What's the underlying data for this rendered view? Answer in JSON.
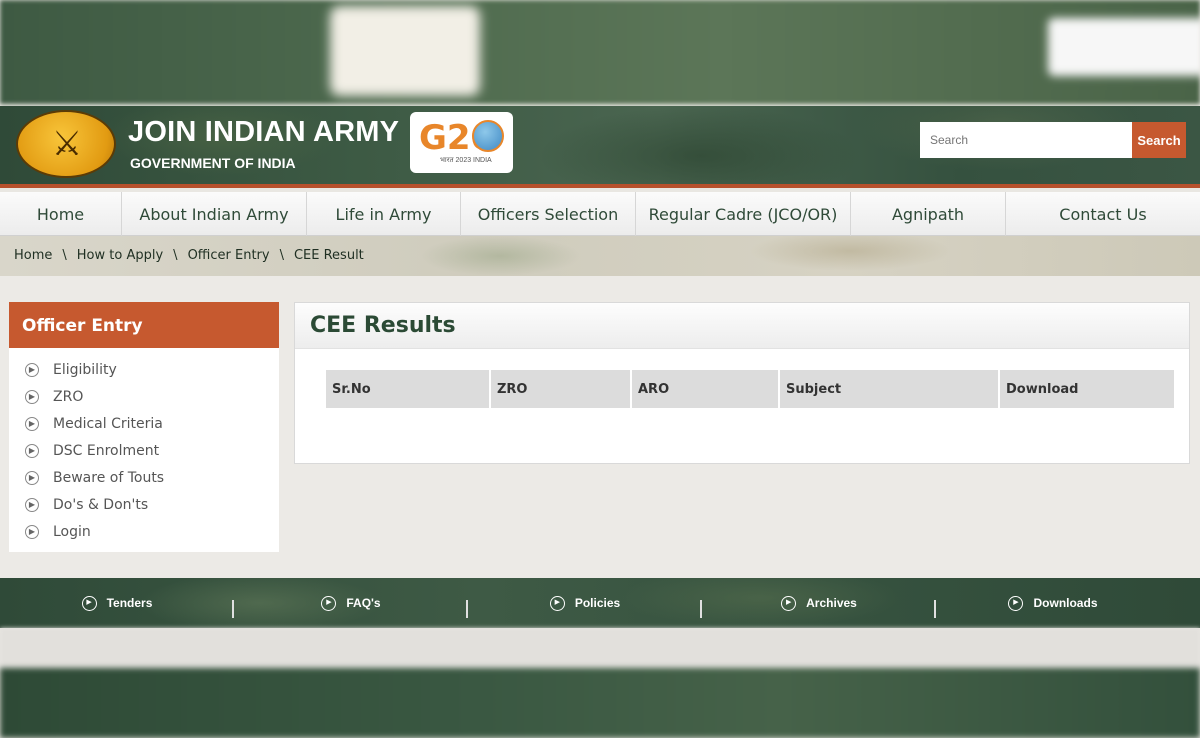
{
  "header": {
    "title": "JOIN INDIAN ARMY",
    "subtitle": "GOVERNMENT OF INDIA",
    "g20_logo_text": "G20",
    "g20_tagline": "भारत 2023 INDIA",
    "search_placeholder": "Search",
    "search_button": "Search"
  },
  "nav": {
    "items": [
      {
        "label": "Home"
      },
      {
        "label": "About Indian Army"
      },
      {
        "label": "Life in Army"
      },
      {
        "label": "Officers Selection"
      },
      {
        "label": "Regular Cadre (JCO/OR)"
      },
      {
        "label": "Agnipath"
      },
      {
        "label": "Contact Us"
      }
    ]
  },
  "breadcrumb": {
    "items": [
      "Home",
      "How to Apply",
      "Officer Entry",
      "CEE Result"
    ],
    "separator": "\\"
  },
  "sidebar": {
    "heading": "Officer Entry",
    "items": [
      "Eligibility",
      "ZRO",
      "Medical Criteria",
      "DSC Enrolment",
      "Beware of Touts",
      "Do's & Don'ts",
      "Login"
    ]
  },
  "panel": {
    "title": "CEE Results",
    "columns": [
      "Sr.No",
      "ZRO",
      "ARO",
      "Subject",
      "Download"
    ]
  },
  "footer": {
    "links": [
      "Tenders",
      "FAQ's",
      "Policies",
      "Archives",
      "Downloads"
    ]
  },
  "colors": {
    "accent": "#c6592f",
    "header_green": "#3d5a44",
    "nav_text": "#2f4a38"
  }
}
